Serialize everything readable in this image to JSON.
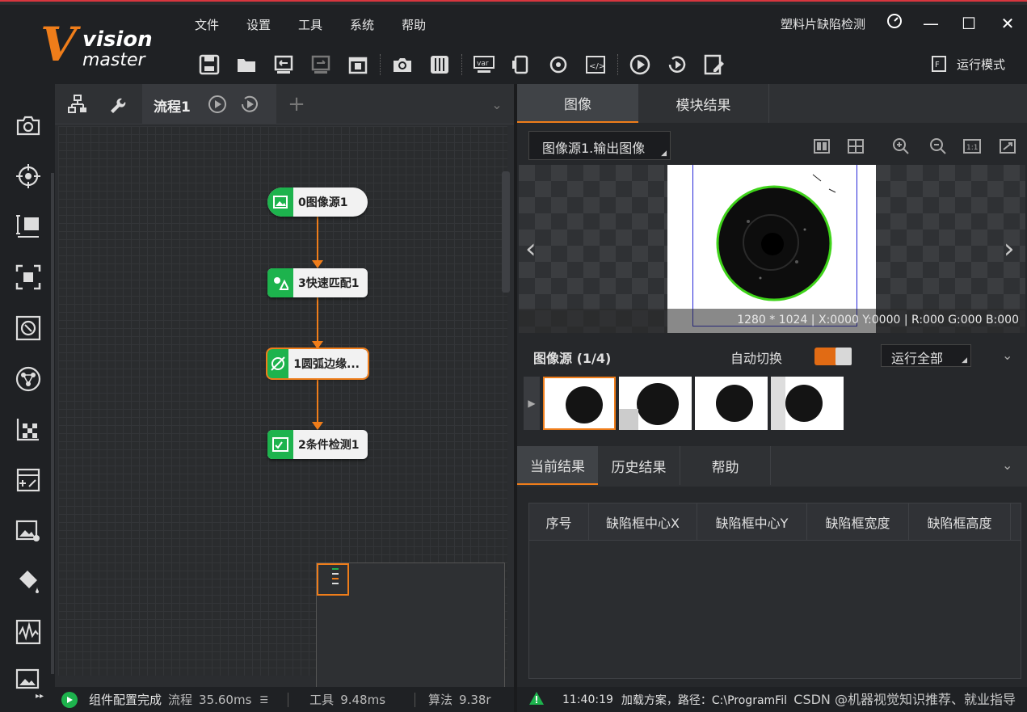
{
  "header": {
    "logo_v": "V",
    "logo_line1": "vision",
    "logo_line2": "master",
    "menus": [
      "文件",
      "设置",
      "工具",
      "系统",
      "帮助"
    ],
    "solution_title": "塑料片缺陷检测",
    "run_mode_label": "运行模式"
  },
  "flow": {
    "tab_label": "流程1",
    "nodes": [
      {
        "label": "0图像源1"
      },
      {
        "label": "3快速匹配1"
      },
      {
        "label": "1圆弧边缘..."
      },
      {
        "label": "2条件检测1"
      }
    ],
    "colors": {
      "node_icon_bg": "#1db34d",
      "connector": "#ef7d1a",
      "selected_outline": "#ef7d1a"
    }
  },
  "status": {
    "config_done": "组件配置完成",
    "flow_label": "流程",
    "flow_time": "35.60ms",
    "tool_label": "工具",
    "tool_time": "9.48ms",
    "algo_label": "算法",
    "algo_time": "9.38r"
  },
  "image_panel": {
    "tabs": [
      "图像",
      "模块结果"
    ],
    "source_select": "图像源1.输出图像",
    "info": "1280 * 1024 | X:0000 Y:0000 | R:000 G:000 B:000",
    "source_count_label": "图像源 (1/4)",
    "auto_switch_label": "自动切换",
    "run_all_label": "运行全部"
  },
  "results": {
    "tabs": [
      "当前结果",
      "历史结果",
      "帮助"
    ],
    "columns": [
      "序号",
      "缺陷框中心X",
      "缺陷框中心Y",
      "缺陷框宽度",
      "缺陷框高度"
    ]
  },
  "log": {
    "time": "11:40:19",
    "message": "加载方案，路径：C:\\ProgramFil",
    "watermark": "CSDN @机器视觉知识推荐、就业指导"
  }
}
